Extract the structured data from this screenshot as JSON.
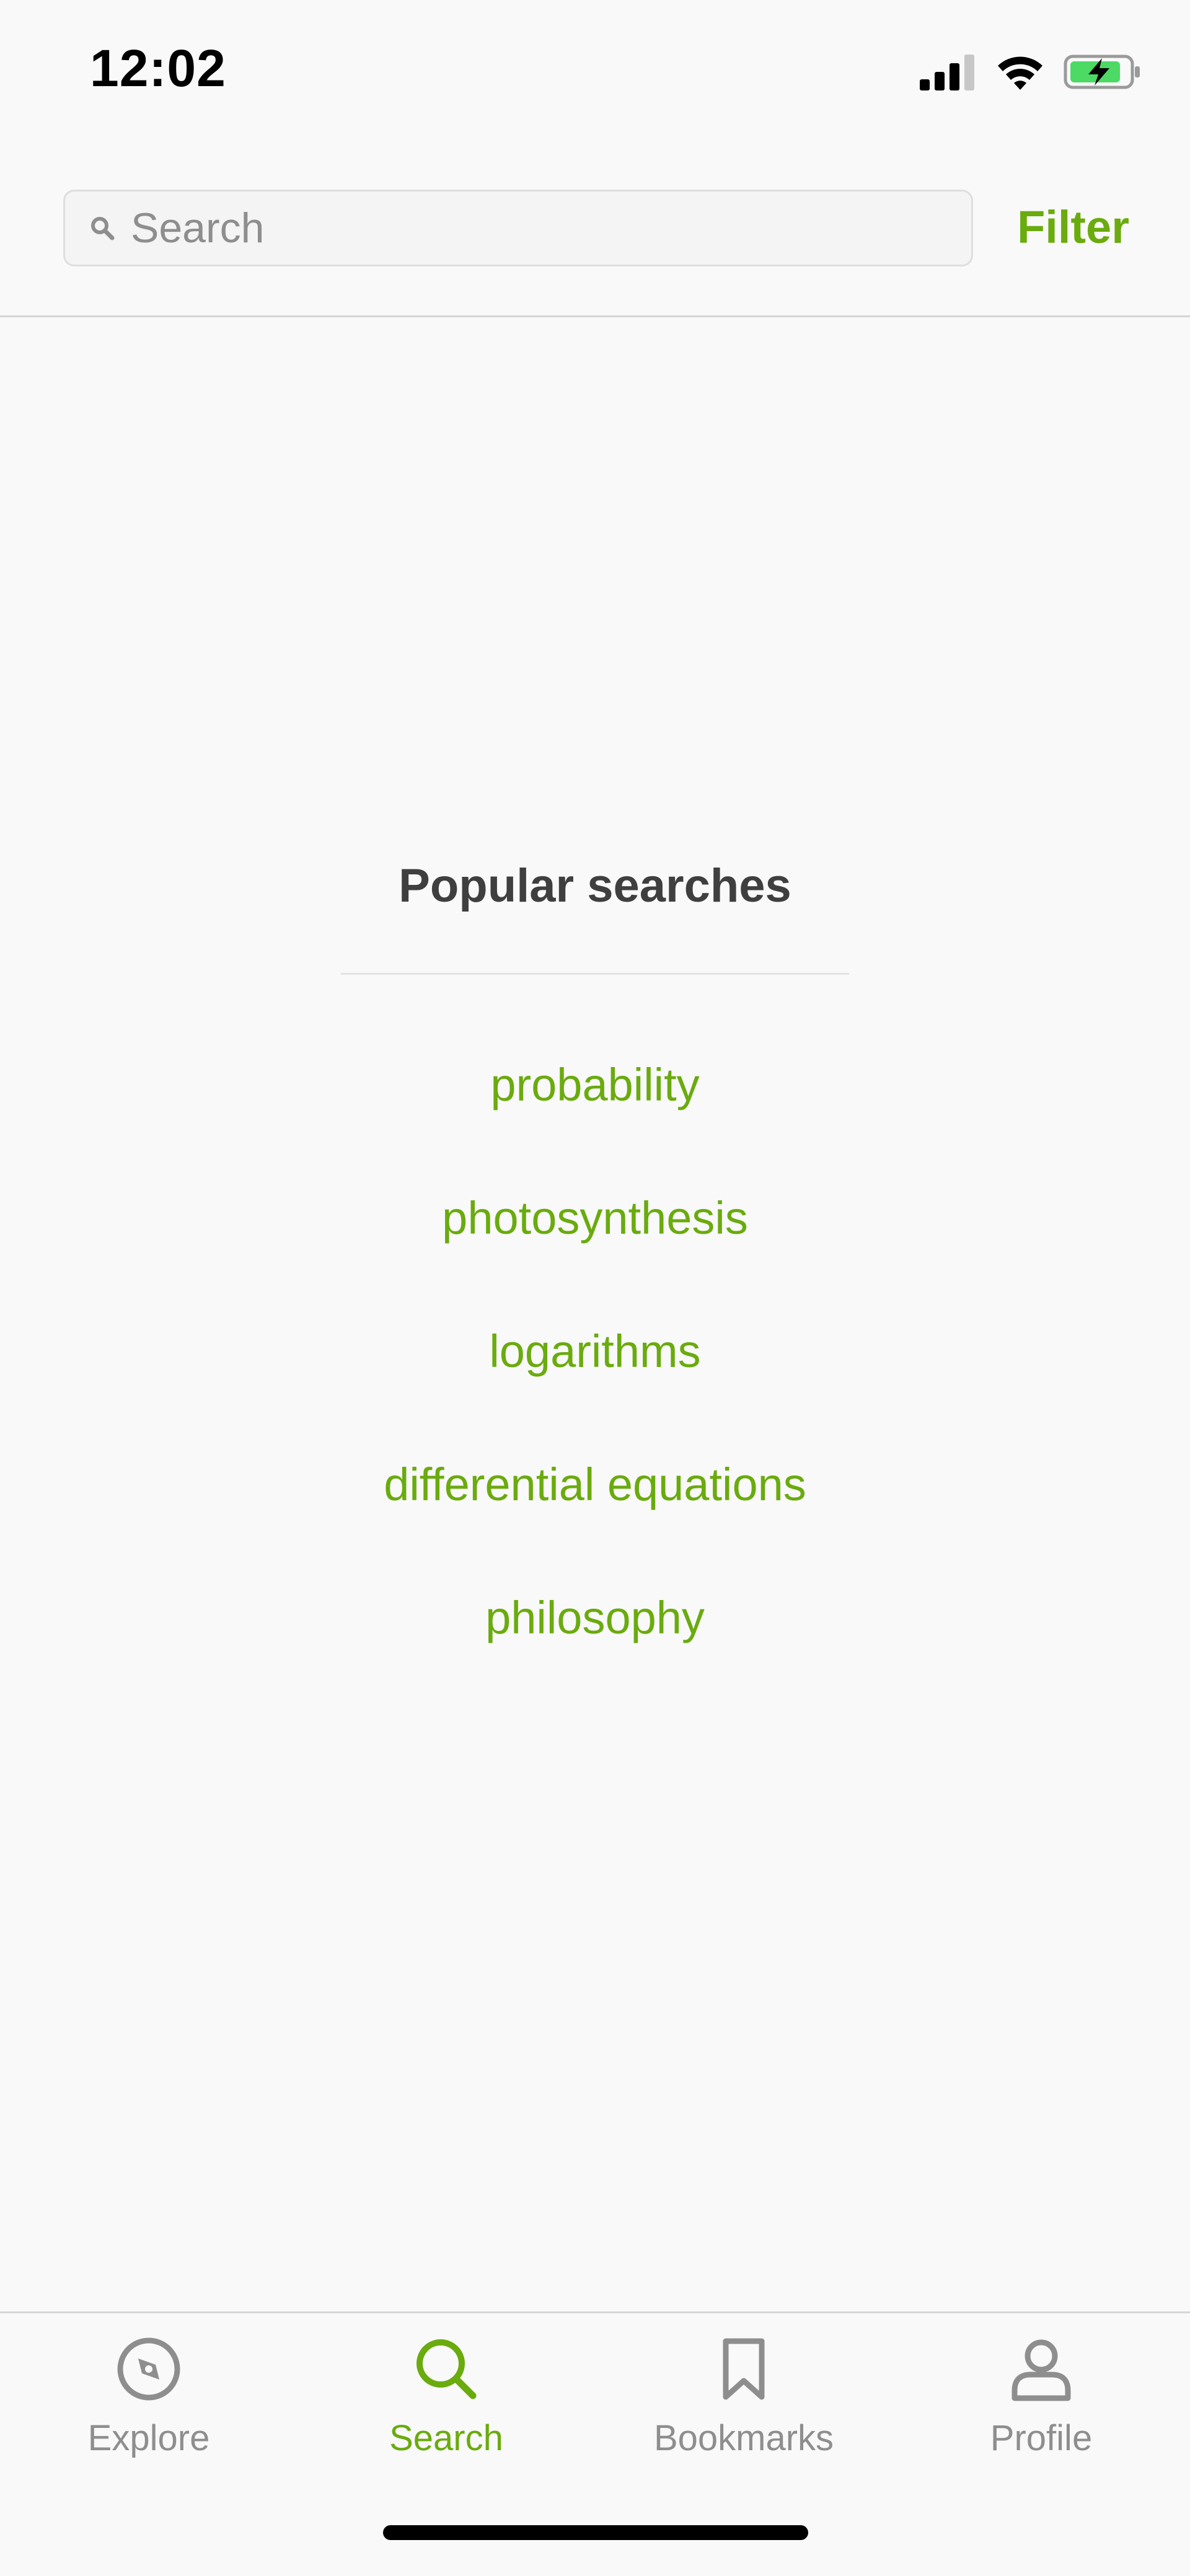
{
  "status_bar": {
    "time": "12:02",
    "icons": [
      "cellular-signal-icon",
      "wifi-icon",
      "battery-charging-icon"
    ]
  },
  "header": {
    "search_placeholder": "Search",
    "search_value": "",
    "filter_label": "Filter"
  },
  "popular": {
    "title": "Popular searches",
    "items": [
      {
        "label": "probability"
      },
      {
        "label": "photosynthesis"
      },
      {
        "label": "logarithms"
      },
      {
        "label": "differential equations"
      },
      {
        "label": "philosophy"
      }
    ]
  },
  "tab_bar": {
    "active": "Search",
    "tabs": [
      {
        "label": "Explore",
        "icon": "compass-icon"
      },
      {
        "label": "Search",
        "icon": "search-icon"
      },
      {
        "label": "Bookmarks",
        "icon": "bookmark-icon"
      },
      {
        "label": "Profile",
        "icon": "profile-icon"
      }
    ]
  },
  "colors": {
    "accent": "#6aab0e",
    "inactive": "#8e8e8e",
    "title": "#3f3f3f",
    "background": "#f9f9f9",
    "battery_fill": "#4cd964"
  }
}
